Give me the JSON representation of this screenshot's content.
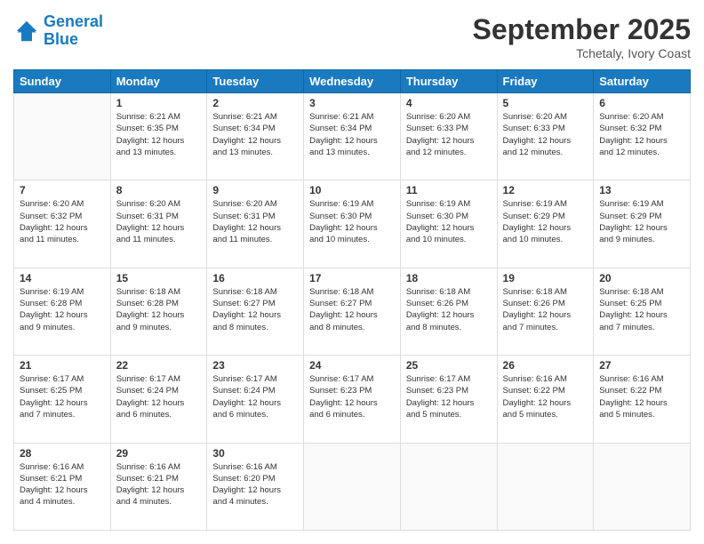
{
  "logo": {
    "text_general": "General",
    "text_blue": "Blue"
  },
  "header": {
    "month": "September 2025",
    "location": "Tchetaly, Ivory Coast"
  },
  "weekdays": [
    "Sunday",
    "Monday",
    "Tuesday",
    "Wednesday",
    "Thursday",
    "Friday",
    "Saturday"
  ],
  "weeks": [
    [
      {
        "day": "",
        "info": ""
      },
      {
        "day": "1",
        "info": "Sunrise: 6:21 AM\nSunset: 6:35 PM\nDaylight: 12 hours\nand 13 minutes."
      },
      {
        "day": "2",
        "info": "Sunrise: 6:21 AM\nSunset: 6:34 PM\nDaylight: 12 hours\nand 13 minutes."
      },
      {
        "day": "3",
        "info": "Sunrise: 6:21 AM\nSunset: 6:34 PM\nDaylight: 12 hours\nand 13 minutes."
      },
      {
        "day": "4",
        "info": "Sunrise: 6:20 AM\nSunset: 6:33 PM\nDaylight: 12 hours\nand 12 minutes."
      },
      {
        "day": "5",
        "info": "Sunrise: 6:20 AM\nSunset: 6:33 PM\nDaylight: 12 hours\nand 12 minutes."
      },
      {
        "day": "6",
        "info": "Sunrise: 6:20 AM\nSunset: 6:32 PM\nDaylight: 12 hours\nand 12 minutes."
      }
    ],
    [
      {
        "day": "7",
        "info": "Sunrise: 6:20 AM\nSunset: 6:32 PM\nDaylight: 12 hours\nand 11 minutes."
      },
      {
        "day": "8",
        "info": "Sunrise: 6:20 AM\nSunset: 6:31 PM\nDaylight: 12 hours\nand 11 minutes."
      },
      {
        "day": "9",
        "info": "Sunrise: 6:20 AM\nSunset: 6:31 PM\nDaylight: 12 hours\nand 11 minutes."
      },
      {
        "day": "10",
        "info": "Sunrise: 6:19 AM\nSunset: 6:30 PM\nDaylight: 12 hours\nand 10 minutes."
      },
      {
        "day": "11",
        "info": "Sunrise: 6:19 AM\nSunset: 6:30 PM\nDaylight: 12 hours\nand 10 minutes."
      },
      {
        "day": "12",
        "info": "Sunrise: 6:19 AM\nSunset: 6:29 PM\nDaylight: 12 hours\nand 10 minutes."
      },
      {
        "day": "13",
        "info": "Sunrise: 6:19 AM\nSunset: 6:29 PM\nDaylight: 12 hours\nand 9 minutes."
      }
    ],
    [
      {
        "day": "14",
        "info": "Sunrise: 6:19 AM\nSunset: 6:28 PM\nDaylight: 12 hours\nand 9 minutes."
      },
      {
        "day": "15",
        "info": "Sunrise: 6:18 AM\nSunset: 6:28 PM\nDaylight: 12 hours\nand 9 minutes."
      },
      {
        "day": "16",
        "info": "Sunrise: 6:18 AM\nSunset: 6:27 PM\nDaylight: 12 hours\nand 8 minutes."
      },
      {
        "day": "17",
        "info": "Sunrise: 6:18 AM\nSunset: 6:27 PM\nDaylight: 12 hours\nand 8 minutes."
      },
      {
        "day": "18",
        "info": "Sunrise: 6:18 AM\nSunset: 6:26 PM\nDaylight: 12 hours\nand 8 minutes."
      },
      {
        "day": "19",
        "info": "Sunrise: 6:18 AM\nSunset: 6:26 PM\nDaylight: 12 hours\nand 7 minutes."
      },
      {
        "day": "20",
        "info": "Sunrise: 6:18 AM\nSunset: 6:25 PM\nDaylight: 12 hours\nand 7 minutes."
      }
    ],
    [
      {
        "day": "21",
        "info": "Sunrise: 6:17 AM\nSunset: 6:25 PM\nDaylight: 12 hours\nand 7 minutes."
      },
      {
        "day": "22",
        "info": "Sunrise: 6:17 AM\nSunset: 6:24 PM\nDaylight: 12 hours\nand 6 minutes."
      },
      {
        "day": "23",
        "info": "Sunrise: 6:17 AM\nSunset: 6:24 PM\nDaylight: 12 hours\nand 6 minutes."
      },
      {
        "day": "24",
        "info": "Sunrise: 6:17 AM\nSunset: 6:23 PM\nDaylight: 12 hours\nand 6 minutes."
      },
      {
        "day": "25",
        "info": "Sunrise: 6:17 AM\nSunset: 6:23 PM\nDaylight: 12 hours\nand 5 minutes."
      },
      {
        "day": "26",
        "info": "Sunrise: 6:16 AM\nSunset: 6:22 PM\nDaylight: 12 hours\nand 5 minutes."
      },
      {
        "day": "27",
        "info": "Sunrise: 6:16 AM\nSunset: 6:22 PM\nDaylight: 12 hours\nand 5 minutes."
      }
    ],
    [
      {
        "day": "28",
        "info": "Sunrise: 6:16 AM\nSunset: 6:21 PM\nDaylight: 12 hours\nand 4 minutes."
      },
      {
        "day": "29",
        "info": "Sunrise: 6:16 AM\nSunset: 6:21 PM\nDaylight: 12 hours\nand 4 minutes."
      },
      {
        "day": "30",
        "info": "Sunrise: 6:16 AM\nSunset: 6:20 PM\nDaylight: 12 hours\nand 4 minutes."
      },
      {
        "day": "",
        "info": ""
      },
      {
        "day": "",
        "info": ""
      },
      {
        "day": "",
        "info": ""
      },
      {
        "day": "",
        "info": ""
      }
    ]
  ]
}
